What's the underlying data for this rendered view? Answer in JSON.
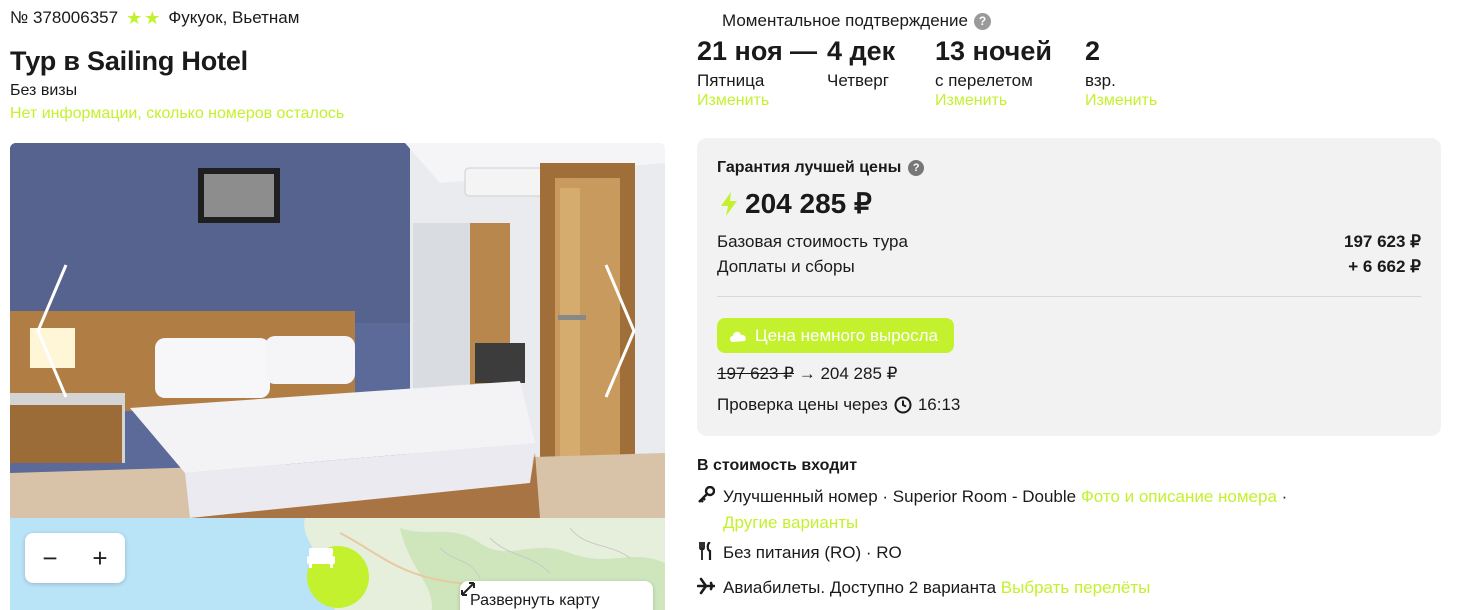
{
  "tour": {
    "number": "№ 378006357",
    "location": "Фукуок, Вьетнам",
    "title": "Тур в Sailing Hotel",
    "visa": "Без визы",
    "rooms_info": "Нет информации, сколько номеров осталось"
  },
  "icons": {
    "stars": [
      "star-icon",
      "star-icon"
    ],
    "photo_prev": "chevron-left-icon",
    "photo_next": "chevron-right-icon",
    "zoom_out": "minus-icon",
    "zoom_in": "plus-icon",
    "map_pin": "bed-icon",
    "expand": "expand-icon",
    "question": "question-icon",
    "lightning": "lightning-icon",
    "cloud": "cloud-icon",
    "clock": "clock-icon",
    "key": "key-icon",
    "food": "fork-knife-icon",
    "plane": "plane-icon"
  },
  "map": {
    "zoom_out": "−",
    "zoom_in": "+",
    "expand_label": "Развернуть карту"
  },
  "booking": {
    "instant_confirmation": "Моментальное подтверждение",
    "question_mark": "?",
    "date_from": "21 ноя",
    "dash": "—",
    "date_to": "4 дек",
    "day_from": "Пятница",
    "day_to": "Четверг",
    "nights": "13 ночей",
    "nights_note": "с перелетом",
    "adults": "2",
    "adults_label": "взр.",
    "change_label": "Изменить"
  },
  "price": {
    "guarantee": "Гарантия лучшей цены",
    "total": "204 285 ₽",
    "base_label": "Базовая стоимость тура",
    "base_value": "197 623 ₽",
    "fees_label": "Доплаты и сборы",
    "fees_value": "+ 6 662 ₽",
    "badge": "Цена немного выросла",
    "old_price": "197 623 ₽",
    "arrow": "→",
    "new_price": "204 285 ₽",
    "check_label": "Проверка цены через",
    "check_time": "16:13"
  },
  "included": {
    "title": "В стоимость входит",
    "room_text": "Улучшенный номер · Superior Room - Double",
    "room_link": "Фото и описание номера",
    "room_sep": "·",
    "room_link2": "Другие варианты",
    "food_text": "Без питания (RO) · RO",
    "flight_text": "Авиабилеты. Доступно 2 варианта",
    "flight_link": "Выбрать перелёты"
  },
  "colors": {
    "accent": "#c4f12e",
    "price_box_bg": "#f2f2f2",
    "map_water": "#b9e3f7"
  }
}
